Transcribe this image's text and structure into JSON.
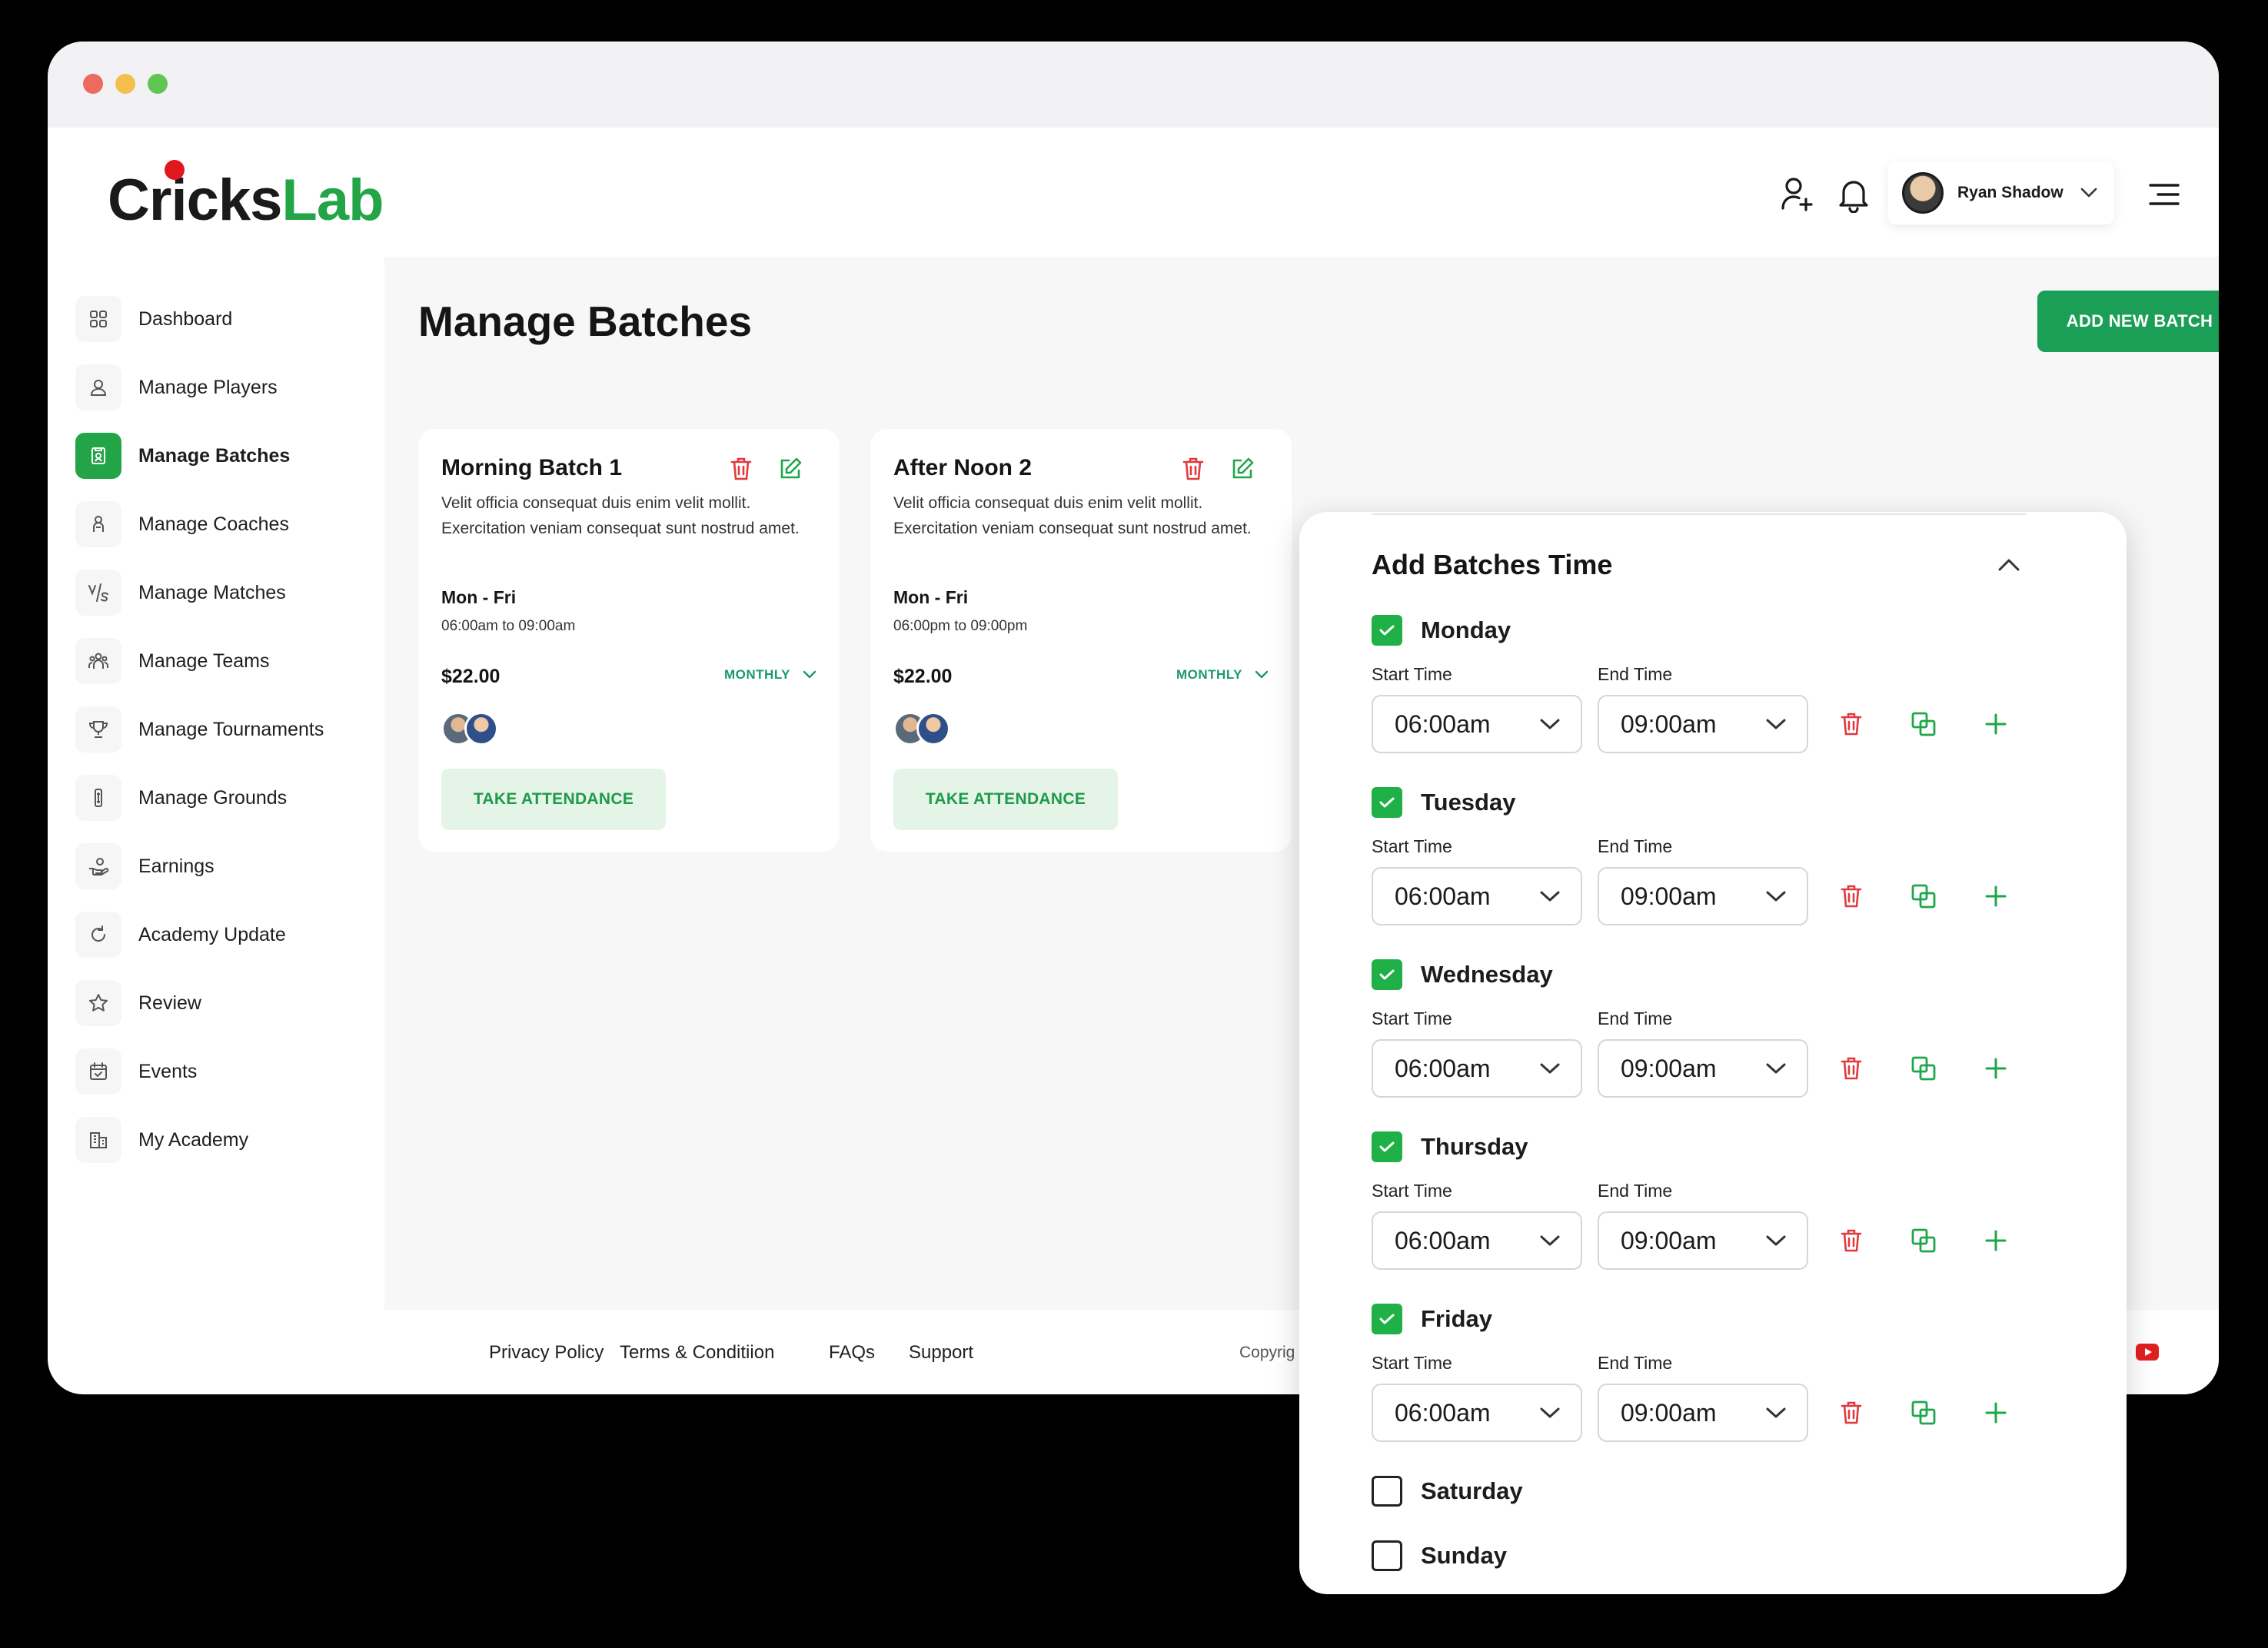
{
  "app": {
    "logo_part1": "Cricks",
    "logo_part2": "Lab"
  },
  "header": {
    "user_name": "Ryan Shadow"
  },
  "sidebar": {
    "items": [
      {
        "label": "Dashboard",
        "icon": "dashboard-icon"
      },
      {
        "label": "Manage Players",
        "icon": "user-icon"
      },
      {
        "label": "Manage Batches",
        "icon": "batch-icon",
        "active": true
      },
      {
        "label": "Manage Coaches",
        "icon": "coach-icon"
      },
      {
        "label": "Manage Matches",
        "icon": "versus-icon"
      },
      {
        "label": "Manage Teams",
        "icon": "team-icon"
      },
      {
        "label": "Manage Tournaments",
        "icon": "trophy-icon"
      },
      {
        "label": "Manage Grounds",
        "icon": "ground-icon"
      },
      {
        "label": "Earnings",
        "icon": "earnings-icon"
      },
      {
        "label": "Academy Update",
        "icon": "refresh-icon"
      },
      {
        "label": "Review",
        "icon": "star-icon"
      },
      {
        "label": "Events",
        "icon": "calendar-icon"
      },
      {
        "label": "My Academy",
        "icon": "building-icon"
      }
    ]
  },
  "main": {
    "title": "Manage Batches",
    "add_button": "ADD NEW BATCH",
    "cards": [
      {
        "title": "Morning Batch 1",
        "description": "Velit officia consequat duis enim velit mollit. Exercitation veniam consequat sunt nostrud amet.",
        "days": "Mon - Fri",
        "time": "06:00am to 09:00am",
        "price": "$22.00",
        "plan": "MONTHLY",
        "button": "TAKE ATTENDANCE"
      },
      {
        "title": "After Noon 2",
        "description": "Velit officia consequat duis enim velit mollit. Exercitation veniam consequat sunt nostrud amet.",
        "days": "Mon - Fri",
        "time": "06:00pm to 09:00pm",
        "price": "$22.00",
        "plan": "MONTHLY",
        "button": "TAKE ATTENDANCE"
      }
    ]
  },
  "footer": {
    "links": [
      "Privacy Policy",
      "Terms & Conditiion",
      "FAQs",
      "Support"
    ],
    "copyright": "Copyrig"
  },
  "panel": {
    "title": "Add Batches Time",
    "start_label": "Start Time",
    "end_label": "End Time",
    "days": [
      {
        "name": "Monday",
        "checked": true,
        "start": "06:00am",
        "end": "09:00am"
      },
      {
        "name": "Tuesday",
        "checked": true,
        "start": "06:00am",
        "end": "09:00am"
      },
      {
        "name": "Wednesday",
        "checked": true,
        "start": "06:00am",
        "end": "09:00am"
      },
      {
        "name": "Thursday",
        "checked": true,
        "start": "06:00am",
        "end": "09:00am"
      },
      {
        "name": "Friday",
        "checked": true,
        "start": "06:00am",
        "end": "09:00am"
      },
      {
        "name": "Saturday",
        "checked": false
      },
      {
        "name": "Sunday",
        "checked": false
      }
    ]
  },
  "colors": {
    "brand_green": "#22a447",
    "danger_red": "#e0393e",
    "accent_teal": "#1a9a6a"
  }
}
